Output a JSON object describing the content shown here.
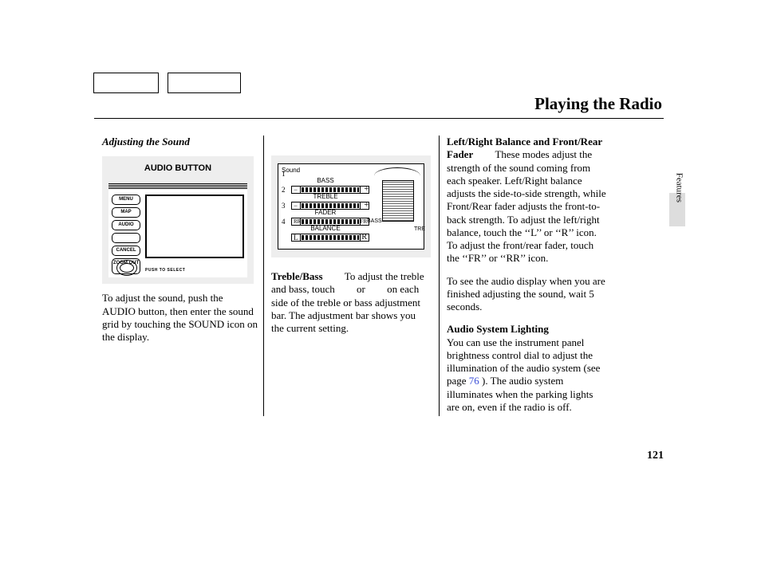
{
  "header": {
    "title": "Playing the Radio"
  },
  "side": {
    "section": "Features",
    "page_number": "121"
  },
  "col1": {
    "subhead": "Adjusting the Sound",
    "figure": {
      "label": "AUDIO BUTTON",
      "buttons": [
        "MENU",
        "MAP",
        "AUDIO",
        "",
        "CANCEL",
        "ZOOM OUT"
      ],
      "knob_label": "PUSH TO SELECT"
    },
    "para": "To adjust the sound, push the AUDIO button, then enter the sound grid by touching the SOUND icon on the display."
  },
  "col2": {
    "figure": {
      "screen_title": "Sound",
      "rows": [
        {
          "n": "1",
          "label": "BASS",
          "left": "−",
          "right": "+"
        },
        {
          "n": "2",
          "label": "TREBLE",
          "left": "−",
          "right": "+"
        },
        {
          "n": "3",
          "label": "FADER",
          "left": "RR",
          "right": "FR"
        },
        {
          "n": "4",
          "label": "BALANCE",
          "left": "L",
          "right": "R"
        }
      ],
      "diag_labels": {
        "bass": "BASS",
        "tre": "TRE"
      }
    },
    "para_lead": "Treble/Bass",
    "para_a": "To adjust the treble and bass, touch",
    "para_b": "or",
    "para_c": "on each side of the treble or bass adjustment bar. The adjustment bar shows you the current setting."
  },
  "col3": {
    "p1_lead": "Left/Right Balance and Front/Rear Fader",
    "p1": "These modes adjust the strength of the sound coming from each speaker. Left/Right balance adjusts the side-to-side strength, while Front/Rear fader adjusts the front-to-back strength. To adjust the left/right balance, touch the ‘‘L’’ or ‘‘R’’ icon. To adjust the front/rear fader, touch the ‘‘FR’’ or ‘‘RR’’ icon.",
    "p2": "To see the audio display when you are finished adjusting the sound, wait 5 seconds.",
    "p3_lead": "Audio System Lighting",
    "p3a": "You can use the instrument panel brightness control dial to adjust the illumination of the audio system (see page ",
    "p3_link": "76",
    "p3b": " ). The audio system illuminates when the parking lights are on, even if the radio is off."
  }
}
